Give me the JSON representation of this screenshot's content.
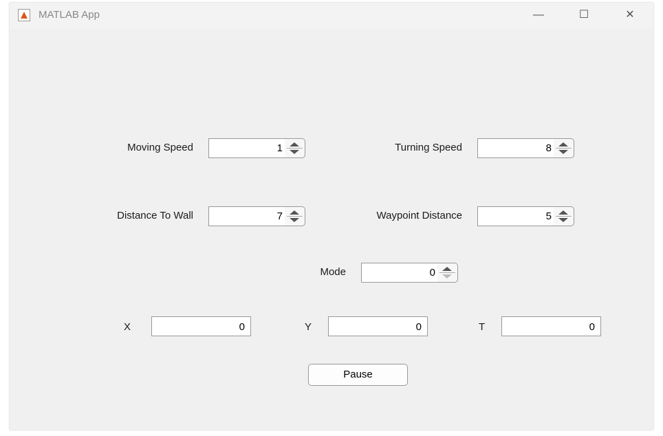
{
  "window": {
    "title": "MATLAB App",
    "minimize": "—",
    "maximize": "☐",
    "close": "✕"
  },
  "spinners": {
    "moving_speed": {
      "label": "Moving Speed",
      "value": "1"
    },
    "turning_speed": {
      "label": "Turning Speed",
      "value": "8"
    },
    "distance_to_wall": {
      "label": "Distance To Wall",
      "value": "7"
    },
    "waypoint_distance": {
      "label": "Waypoint Distance",
      "value": "5"
    },
    "mode": {
      "label": "Mode",
      "value": "0"
    }
  },
  "fields": {
    "x": {
      "label": "X",
      "value": "0"
    },
    "y": {
      "label": "Y",
      "value": "0"
    },
    "t": {
      "label": "T",
      "value": "0"
    }
  },
  "pause_label": "Pause"
}
